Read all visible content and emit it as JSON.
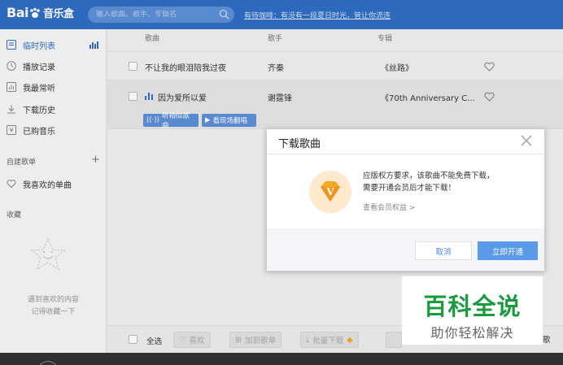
{
  "app": {
    "logo_text": "Bai",
    "logo_sub": "音乐盒",
    "search_placeholder": "输入歌曲、歌手、专辑名",
    "marquee": "有待咖啡：有没有一段夏日时光，管让你流连"
  },
  "sidebar": {
    "items": [
      {
        "label": "临时列表",
        "icon": "playlist-icon"
      },
      {
        "label": "播放记录",
        "icon": "clock-icon"
      },
      {
        "label": "我最常听",
        "icon": "chart-icon"
      },
      {
        "label": "下载历史",
        "icon": "download-icon"
      },
      {
        "label": "已购音乐",
        "icon": "yen-icon"
      }
    ],
    "custom_section": "自建歌单",
    "favorites": "我喜欢的单曲",
    "collect_section": "收藏",
    "empty_line1": "遇到喜欢的内容",
    "empty_line2": "记得收藏一下"
  },
  "list": {
    "headers": {
      "song": "歌曲",
      "artist": "歌手",
      "album": "专辑"
    },
    "rows": [
      {
        "song": "不让我的眼泪陪我过夜",
        "artist": "齐秦",
        "album": "《丝路》"
      },
      {
        "song": "因为爱所以爱",
        "artist": "谢霆锋",
        "album": "《70th Anniversary C..."
      }
    ],
    "actions": {
      "similar": "听相似歌曲",
      "live": "看现场翻唱"
    }
  },
  "toolbar": {
    "select_all": "全选",
    "like": "喜欢",
    "add_playlist": "加到歌单",
    "batch_download": "批量下载",
    "peek": "歌"
  },
  "dialog": {
    "title": "下载歌曲",
    "message_line1": "应版权方要求，该歌曲不能免费下载，",
    "message_line2": "需要开通会员后才能下载！",
    "link": "查看会员权益 >",
    "cancel": "取消",
    "confirm": "立即开通",
    "accent": "#5a9ae8",
    "badge_color": "#f5a623"
  },
  "watermark": {
    "title": "百科全说",
    "subtitle": "助你轻松解决"
  }
}
